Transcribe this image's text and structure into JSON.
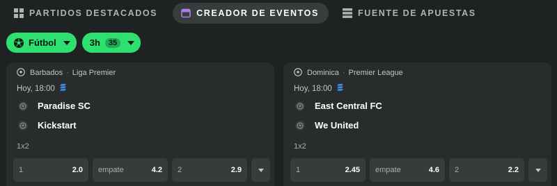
{
  "tabs": [
    {
      "label": "PARTIDOS DESTACADOS",
      "icon": "grid-icon",
      "active": false
    },
    {
      "label": "CREADOR DE EVENTOS",
      "icon": "calendar-icon",
      "active": true
    },
    {
      "label": "FUENTE DE APUESTAS",
      "icon": "feed-icon",
      "active": false
    }
  ],
  "filters": {
    "sport": {
      "label": "Fútbol",
      "icon": "soccer-ball-icon"
    },
    "timeframe": {
      "label": "3h",
      "count": "35"
    }
  },
  "events": [
    {
      "country": "Barbados",
      "league": "Liga Premier",
      "time": "Hoy, 18:00",
      "home": "Paradise SC",
      "away": "Kickstart",
      "market": "1x2",
      "odds": [
        {
          "label": "1",
          "value": "2.0"
        },
        {
          "label": "empate",
          "value": "4.2"
        },
        {
          "label": "2",
          "value": "2.9"
        }
      ]
    },
    {
      "country": "Dominica",
      "league": "Premier League",
      "time": "Hoy, 18:00",
      "home": "East Central FC",
      "away": "We United",
      "market": "1x2",
      "odds": [
        {
          "label": "1",
          "value": "2.45"
        },
        {
          "label": "empate",
          "value": "4.6"
        },
        {
          "label": "2",
          "value": "2.2"
        }
      ]
    }
  ],
  "colors": {
    "background": "#1f2222",
    "card": "#282c2c",
    "accent_green": "#2ee06f",
    "active_tab": "#373c3c",
    "calendar_accent": "#b07ae8",
    "live_stream_icon": "#3b8fe8"
  }
}
